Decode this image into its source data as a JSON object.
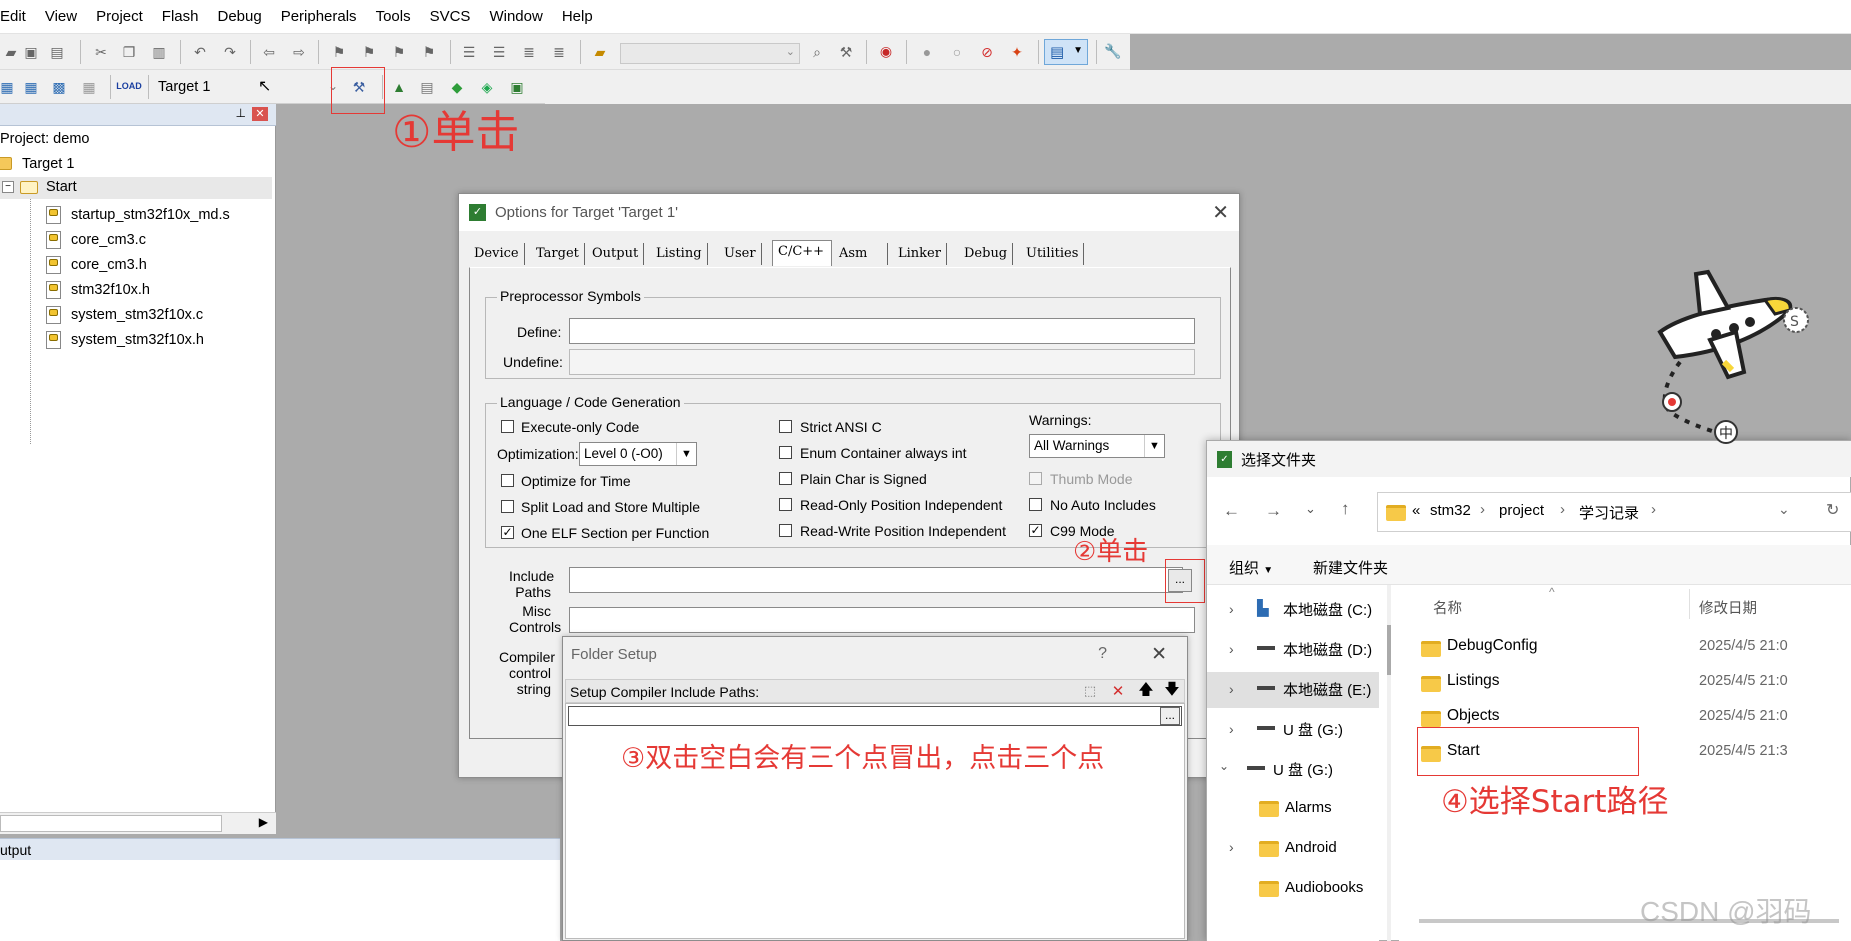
{
  "menu": [
    "Edit",
    "View",
    "Project",
    "Flash",
    "Debug",
    "Peripherals",
    "Tools",
    "SVCS",
    "Window",
    "Help"
  ],
  "toolbar": {
    "target_select": "Target 1"
  },
  "project_panel": {
    "root": "Project: demo",
    "target": "Target 1",
    "group": "Start",
    "files": [
      "startup_stm32f10x_md.s",
      "core_cm3.c",
      "core_cm3.h",
      "stm32f10x.h",
      "system_stm32f10x.c",
      "system_stm32f10x.h"
    ],
    "pin_icon": "pin-icon",
    "close_icon": "close-icon"
  },
  "output_panel": {
    "title": "utput"
  },
  "annotations": {
    "step1": "①单击",
    "step2": "②单击",
    "step3": "③双击空白会有三个点冒出，点击三个点",
    "step4": "④选择Start路径",
    "color": "#e53935"
  },
  "options_dialog": {
    "title": "Options for Target 'Target 1'",
    "tabs": [
      "Device",
      "Target",
      "Output",
      "Listing",
      "User",
      "C/C++",
      "Asm",
      "Linker",
      "Debug",
      "Utilities"
    ],
    "selected_tab": "C/C++",
    "preprocessor": {
      "title": "Preprocessor Symbols",
      "define_label": "Define:",
      "undefine_label": "Undefine:"
    },
    "language": {
      "title": "Language / Code Generation",
      "execute_only": "Execute-only Code",
      "optimization_label": "Optimization:",
      "optimization_value": "Level 0 (-O0)",
      "optimize_time": "Optimize for Time",
      "split_load": "Split Load and Store Multiple",
      "one_elf": "One ELF Section per Function",
      "strict_ansi": "Strict ANSI C",
      "enum_container": "Enum Container always int",
      "plain_char": "Plain Char is Signed",
      "ro_pos": "Read-Only Position Independent",
      "rw_pos": "Read-Write Position Independent",
      "warnings_label": "Warnings:",
      "warnings_value": "All Warnings",
      "thumb_mode": "Thumb Mode",
      "no_auto": "No Auto Includes",
      "c99": "C99 Mode",
      "check_mark": "✓"
    },
    "include_label_1": "Include",
    "include_label_2": "Paths",
    "misc_label_1": "Misc",
    "misc_label_2": "Controls",
    "compiler_label_1": "Compiler",
    "compiler_label_2": "control",
    "compiler_label_3": "string",
    "browse": "..."
  },
  "folder_setup": {
    "title": "Folder Setup",
    "help": "?",
    "close": "✕",
    "label": "Setup Compiler Include Paths:",
    "browse": "..."
  },
  "explorer": {
    "title": "选择文件夹",
    "breadcrumb": [
      "«",
      "stm32",
      "project",
      "学习记录"
    ],
    "organize": "组织",
    "new_folder": "新建文件夹",
    "col_name": "名称",
    "col_date": "修改日期",
    "nav": [
      {
        "label": "本地磁盘 (C:)"
      },
      {
        "label": "本地磁盘 (D:)"
      },
      {
        "label": "本地磁盘 (E:)"
      },
      {
        "label": "U 盘 (G:)"
      },
      {
        "label": "U 盘 (G:)"
      },
      {
        "label": "Alarms"
      },
      {
        "label": "Android"
      },
      {
        "label": "Audiobooks"
      }
    ],
    "files": [
      {
        "name": "DebugConfig",
        "date": "2025/4/5 21:0"
      },
      {
        "name": "Listings",
        "date": "2025/4/5 21:0"
      },
      {
        "name": "Objects",
        "date": "2025/4/5 21:0"
      },
      {
        "name": "Start",
        "date": "2025/4/5 21:3"
      }
    ]
  },
  "watermark": "CSDN @羽码"
}
